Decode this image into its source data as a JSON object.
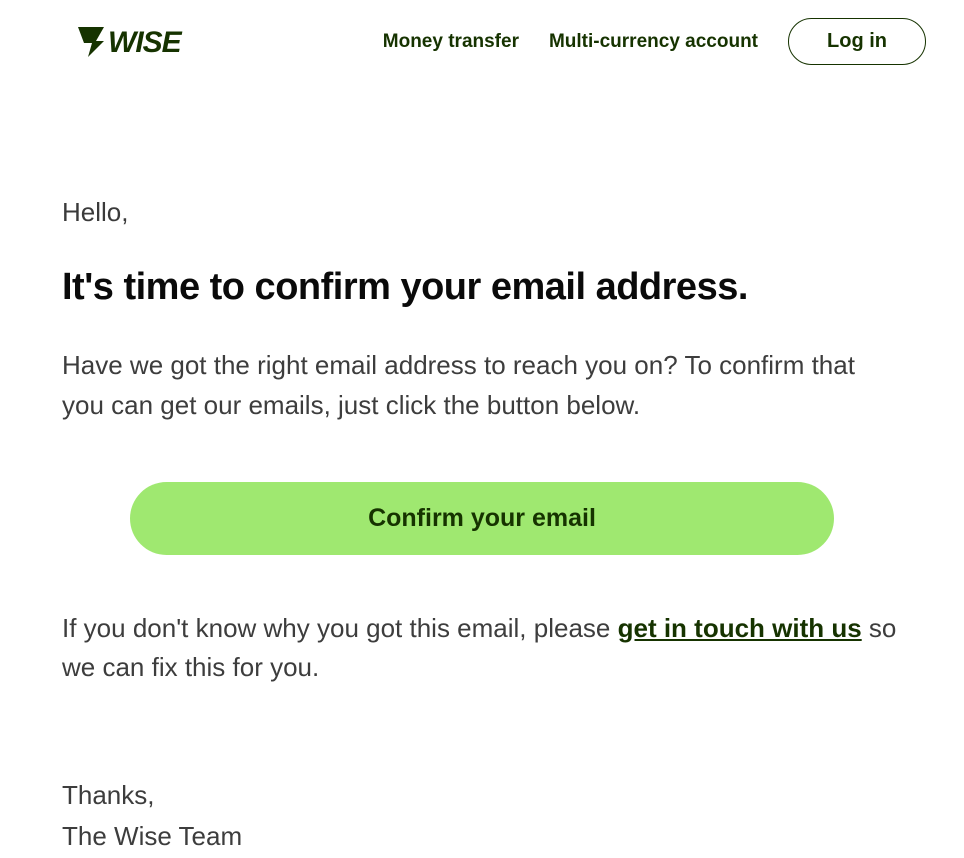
{
  "header": {
    "logo_text": "WISE",
    "nav": {
      "money_transfer": "Money transfer",
      "multi_currency": "Multi-currency account",
      "login": "Log in"
    }
  },
  "email": {
    "greeting": "Hello,",
    "heading": "It's time to confirm your email address.",
    "body": "Have we got the right email address to reach you on? To confirm that you can get our emails, just click the button below.",
    "cta": "Confirm your email",
    "help_prefix": "If you don't know why you got this email, please ",
    "help_link": "get in touch with us",
    "help_suffix": " so we can fix this for you.",
    "thanks": "Thanks,",
    "team": "The Wise Team"
  },
  "colors": {
    "brand_dark": "#163300",
    "brand_green": "#9fe870"
  }
}
